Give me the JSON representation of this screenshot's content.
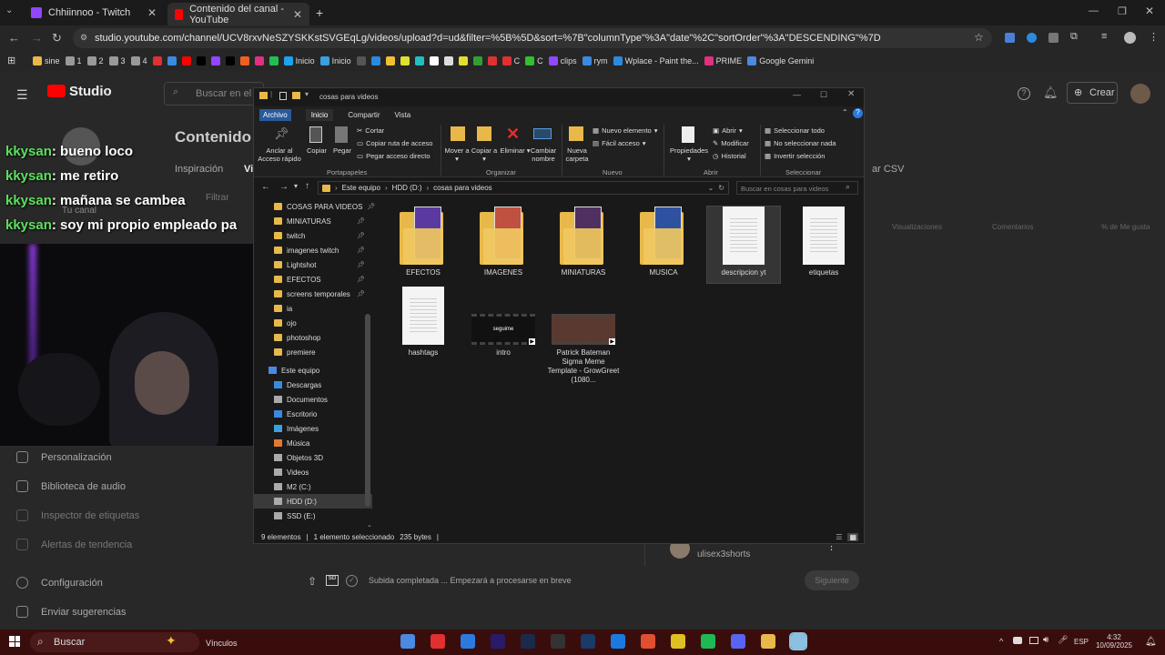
{
  "browser": {
    "tabs": [
      {
        "title": "Chhiinnoo - Twitch",
        "color": "#9146ff"
      },
      {
        "title": "Contenido del canal - YouTube",
        "color": "#ff0000"
      }
    ],
    "url": "studio.youtube.com/channel/UCV8rxvNeSZYSKKstSVGEqLg/videos/upload?d=ud&filter=%5B%5D&sort=%7B\"columnType\"%3A\"date\"%2C\"sortOrder\"%3A\"DESCENDING\"%7D",
    "bookmarks": [
      "sine",
      "1",
      "2",
      "3",
      "4",
      "",
      "",
      "",
      "",
      "",
      "",
      "",
      "",
      "",
      "Inicio",
      "Inicio",
      "",
      "",
      "",
      "",
      "",
      "",
      "",
      "",
      "",
      "",
      "C",
      "C",
      "clips",
      "rym",
      "Wplace - Paint the...",
      "PRIME",
      "Google Gemini"
    ]
  },
  "studio": {
    "logo": "Studio",
    "search_placeholder": "Buscar en el c",
    "page_title": "Contenido d",
    "tab_inspiracion": "Inspiración",
    "tab_partial": "Vi",
    "filter": "Filtrar",
    "tu_canal": "Tu canal",
    "export": "ar CSV",
    "create": "Crear",
    "col_views": "Visualizaciones",
    "col_comments": "Comentarios",
    "col_likes": "% de Me gusta",
    "sidebar": [
      "Personalización",
      "Biblioteca de audio",
      "Inspector de etiquetas",
      "Alertas de tendencia",
      "Configuración",
      "Enviar sugerencias"
    ],
    "upload_status": "Subida completada ... Empezará a procesarse en breve",
    "next_button": "Siguiente",
    "suggested_user": "ulisex3shorts"
  },
  "chat": [
    {
      "user": "kkysan",
      "msg": ": bueno loco"
    },
    {
      "user": "kkysan",
      "msg": ": me retiro"
    },
    {
      "user": "kkysan",
      "msg": ": mañana se cambea"
    },
    {
      "user": "kkysan",
      "msg": ": soy mi propio empleado pa"
    }
  ],
  "explorer": {
    "title": "cosas para videos",
    "ribbon_tabs": [
      "Archivo",
      "Inicio",
      "Compartir",
      "Vista"
    ],
    "ribbon": {
      "anclar": "Anclar al Acceso rápido",
      "copiar": "Copiar",
      "pegar": "Pegar",
      "cortar": "Cortar",
      "copiar_ruta": "Copiar ruta de acceso",
      "pegar_acceso": "Pegar acceso directo",
      "mover": "Mover a",
      "copiar_a": "Copiar a",
      "eliminar": "Eliminar",
      "cambiar": "Cambiar nombre",
      "nueva": "Nueva carpeta",
      "nuevo_elemento": "Nuevo elemento",
      "facil": "Fácil acceso",
      "propiedades": "Propiedades",
      "abrir": "Abrir",
      "modificar": "Modificar",
      "historial": "Historial",
      "sel_todo": "Seleccionar todo",
      "no_sel": "No seleccionar nada",
      "invertir": "Invertir selección",
      "g_portapapeles": "Portapapeles",
      "g_organizar": "Organizar",
      "g_nuevo": "Nuevo",
      "g_abrir": "Abrir",
      "g_seleccionar": "Seleccionar"
    },
    "breadcrumb": [
      "Este equipo",
      "HDD (D:)",
      "cosas para videos"
    ],
    "search_placeholder": "Buscar en cosas para videos",
    "nav": [
      {
        "label": "COSAS PARA VIDEOS",
        "pin": true,
        "kind": "folder"
      },
      {
        "label": "MINIATURAS",
        "pin": true,
        "kind": "folder"
      },
      {
        "label": "twitch",
        "pin": true,
        "kind": "folder"
      },
      {
        "label": "imagenes twitch",
        "pin": true,
        "kind": "folder"
      },
      {
        "label": "Lightshot",
        "pin": true,
        "kind": "folder"
      },
      {
        "label": "EFECTOS",
        "pin": true,
        "kind": "folder"
      },
      {
        "label": "screens temporales",
        "pin": true,
        "kind": "folder"
      },
      {
        "label": "ia",
        "pin": false,
        "kind": "folder"
      },
      {
        "label": "ojo",
        "pin": false,
        "kind": "folder"
      },
      {
        "label": "photoshop",
        "pin": false,
        "kind": "folder"
      },
      {
        "label": "premiere",
        "pin": false,
        "kind": "folder"
      }
    ],
    "nav2": [
      "Este equipo",
      "Descargas",
      "Documentos",
      "Escritorio",
      "Imágenes",
      "Música",
      "Objetos 3D",
      "Videos",
      "M2 (C:)",
      "HDD (D:)",
      "SSD (E:)"
    ],
    "files": [
      {
        "name": "EFECTOS",
        "kind": "folder"
      },
      {
        "name": "IMAGENES",
        "kind": "folder"
      },
      {
        "name": "MINIATURAS",
        "kind": "folder"
      },
      {
        "name": "MUSICA",
        "kind": "folder"
      },
      {
        "name": "descripcion yt",
        "kind": "doc"
      },
      {
        "name": "etiquetas",
        "kind": "doc"
      },
      {
        "name": "hashtags",
        "kind": "doc"
      },
      {
        "name": "intro",
        "kind": "video"
      },
      {
        "name": "Patrick Bateman Sigma Meme Template - GrowGreet (1080...",
        "kind": "video"
      }
    ],
    "intro_thumb_text": "seguime",
    "status_count": "9 elementos",
    "status_selected": "1 elemento seleccionado",
    "status_size": "235 bytes"
  },
  "taskbar": {
    "search": "Buscar",
    "vinculos": "Vínculos",
    "lang": "ESP",
    "time": "4:32",
    "date": "10/09/2025"
  }
}
